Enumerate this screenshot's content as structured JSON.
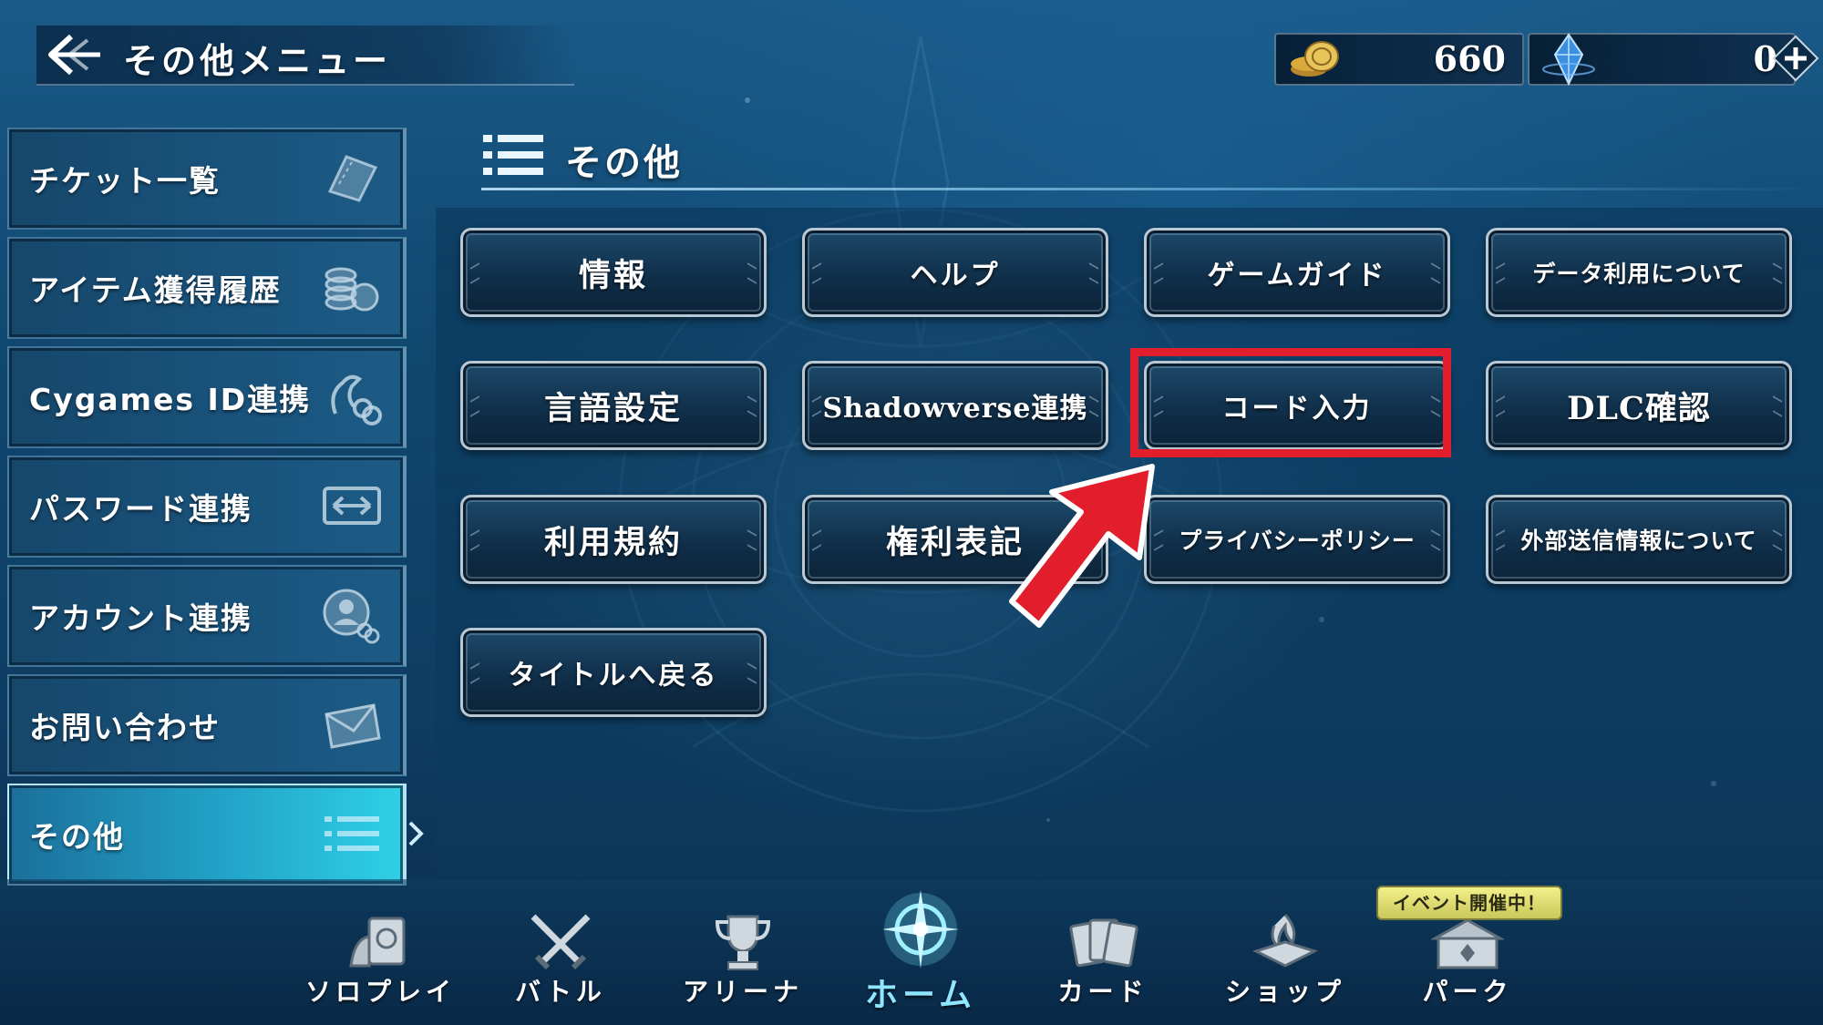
{
  "header": {
    "title": "その他メニュー",
    "coins": {
      "icon": "gold-coins-icon",
      "value": "660"
    },
    "crystals": {
      "icon": "blue-crystal-icon",
      "value": "0"
    },
    "plus_icon": "plus-icon"
  },
  "sidebar": {
    "items": [
      {
        "label": "チケット一覧",
        "icon": "ticket-icon"
      },
      {
        "label": "アイテム獲得履歴",
        "icon": "coin-stack-icon"
      },
      {
        "label": "Cygames ID連携",
        "icon": "dragon-link-icon"
      },
      {
        "label": "パスワード連携",
        "icon": "exchange-arrows-icon"
      },
      {
        "label": "アカウント連携",
        "icon": "user-link-icon"
      },
      {
        "label": "お問い合わせ",
        "icon": "envelope-icon"
      },
      {
        "label": "その他",
        "icon": "list-icon",
        "active": true
      }
    ]
  },
  "main": {
    "section_title": "その他",
    "buttons": [
      {
        "label": "情報"
      },
      {
        "label": "ヘルプ"
      },
      {
        "label": "ゲームガイド"
      },
      {
        "label": "データ利用について"
      },
      {
        "label": "言語設定"
      },
      {
        "label": "Shadowverse連携"
      },
      {
        "label": "コード入力",
        "highlighted": true
      },
      {
        "label": "DLC確認"
      },
      {
        "label": "利用規約"
      },
      {
        "label": "権利表記"
      },
      {
        "label": "プライバシーポリシー"
      },
      {
        "label": "外部送信情報について"
      },
      {
        "label": "タイトルへ戻る"
      }
    ]
  },
  "annotation": {
    "highlight_color": "#e21e2c"
  },
  "bottom_nav": {
    "items": [
      {
        "label": "ソロプレイ",
        "icon": "solo-play-icon"
      },
      {
        "label": "バトル",
        "icon": "crossed-swords-icon"
      },
      {
        "label": "アリーナ",
        "icon": "trophy-icon"
      },
      {
        "label": "ホーム",
        "icon": "home-emblem-icon",
        "active": true
      },
      {
        "label": "カード",
        "icon": "cards-icon"
      },
      {
        "label": "ショップ",
        "icon": "shop-icon"
      },
      {
        "label": "パーク",
        "icon": "park-icon"
      }
    ],
    "event_badge": "イベント開催中！"
  }
}
